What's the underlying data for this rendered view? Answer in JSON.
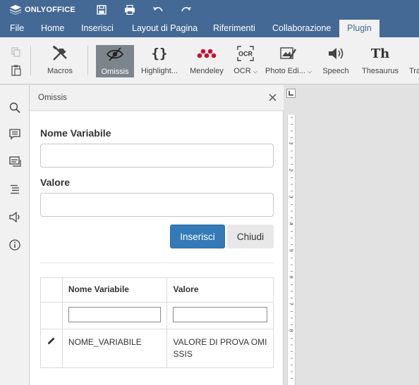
{
  "app": {
    "logo": "ONLYOFFICE"
  },
  "menu": {
    "tabs": [
      {
        "label": "File"
      },
      {
        "label": "Home"
      },
      {
        "label": "Inserisci"
      },
      {
        "label": "Layout di Pagina"
      },
      {
        "label": "Riferimenti"
      },
      {
        "label": "Collaborazione"
      },
      {
        "label": "Plugin",
        "active": true
      }
    ]
  },
  "toolbar": {
    "tools": [
      {
        "label": "Macros",
        "icon": "macros-icon"
      },
      {
        "label": "Omissis",
        "icon": "eye-slash-icon",
        "active": true
      },
      {
        "label": "Highlight...",
        "icon": "braces-icon"
      },
      {
        "label": "Mendeley",
        "icon": "mendeley-icon"
      },
      {
        "label": "OCR",
        "icon": "ocr-icon",
        "dropdown": true
      },
      {
        "label": "Photo Edi...",
        "icon": "photo-editor-icon",
        "dropdown": true
      },
      {
        "label": "Speech",
        "icon": "speaker-icon"
      },
      {
        "label": "Thesaurus",
        "icon": "thesaurus-icon",
        "glyph": "Th"
      },
      {
        "label": "Tra",
        "icon": "translator-icon"
      }
    ]
  },
  "panel": {
    "title": "Omissis",
    "fields": {
      "name_label": "Nome Variabile",
      "name_value": "",
      "value_label": "Valore",
      "value_value": ""
    },
    "buttons": {
      "insert": "Inserisci",
      "close": "Chiudi"
    },
    "table": {
      "headers": [
        "Nome Variabile",
        "Valore"
      ],
      "filters": [
        "",
        ""
      ],
      "rows": [
        {
          "name": "NOME_VARIABILE",
          "value": "VALORE DI PROVA OMISSIS"
        }
      ]
    }
  },
  "ruler": {
    "numbers": [
      "1",
      "2",
      "3",
      "4",
      "5",
      "6",
      "7",
      "8"
    ]
  },
  "colors": {
    "header": "#446995",
    "primary_button": "#337ab7",
    "active_tool": "#7d858c"
  }
}
